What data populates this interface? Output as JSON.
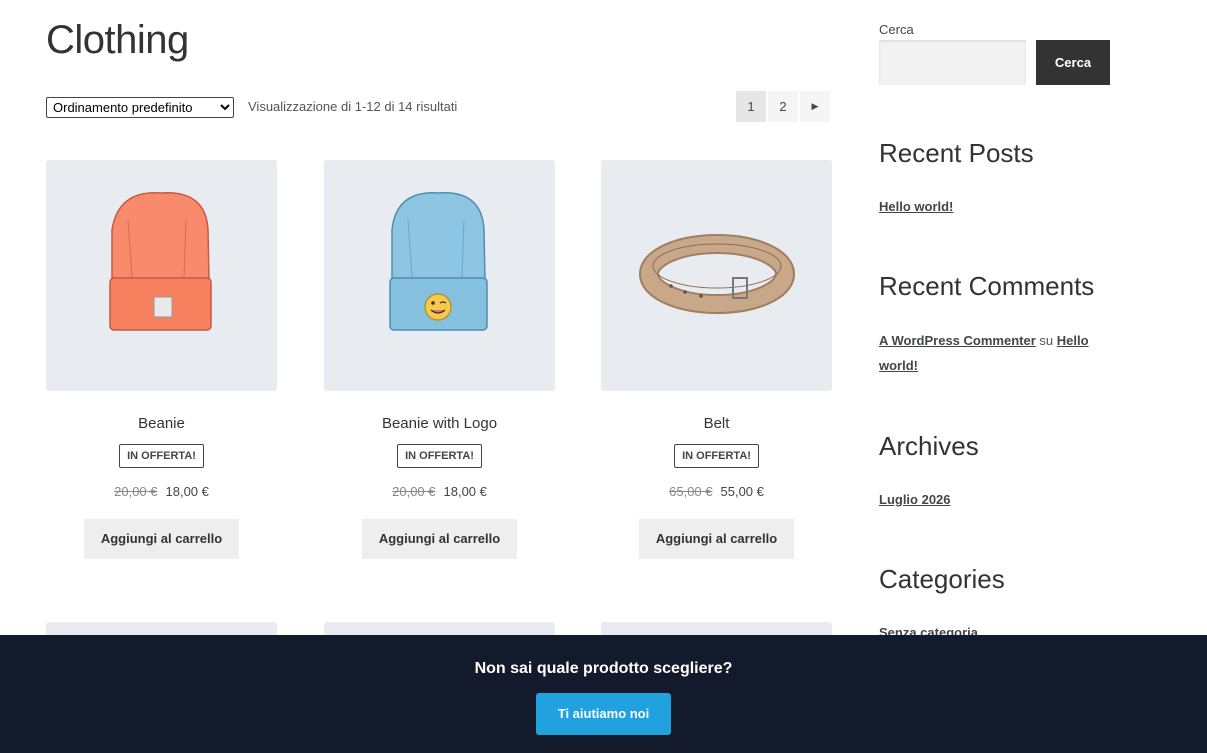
{
  "page": {
    "title": "Clothing"
  },
  "toolbar": {
    "sort_selected": "Ordinamento predefinito",
    "result_count": "Visualizzazione di 1-12 di 14 risultati"
  },
  "pagination": {
    "pages": [
      "1",
      "2"
    ],
    "current": "1",
    "next_icon": "triangle-right-icon"
  },
  "products": [
    {
      "name": "Beanie",
      "badge": "IN OFFERTA!",
      "old_price": "20,00 €",
      "price": "18,00 €",
      "button": "Aggiungi al carrello",
      "image": "orange-beanie"
    },
    {
      "name": "Beanie with Logo",
      "badge": "IN OFFERTA!",
      "old_price": "20,00 €",
      "price": "18,00 €",
      "button": "Aggiungi al carrello",
      "image": "blue-beanie-with-logo"
    },
    {
      "name": "Belt",
      "badge": "IN OFFERTA!",
      "old_price": "65,00 €",
      "price": "55,00 €",
      "button": "Aggiungi al carrello",
      "image": "leather-belt"
    }
  ],
  "sidebar": {
    "search": {
      "label": "Cerca",
      "button": "Cerca"
    },
    "recent_posts": {
      "title": "Recent Posts",
      "items": [
        "Hello world!"
      ]
    },
    "recent_comments": {
      "title": "Recent Comments",
      "author": "A WordPress Commenter",
      "connector": "su",
      "post": "Hello world!"
    },
    "archives": {
      "title": "Archives",
      "items": [
        "Luglio 2026"
      ]
    },
    "categories": {
      "title": "Categories",
      "items": [
        "Senza categoria"
      ]
    }
  },
  "cta": {
    "text": "Non sai quale prodotto scegliere?",
    "button": "Ti aiutiamo noi"
  },
  "colors": {
    "cta_background": "#131a2b",
    "cta_button": "#1fa2dd",
    "search_button": "#333333"
  }
}
